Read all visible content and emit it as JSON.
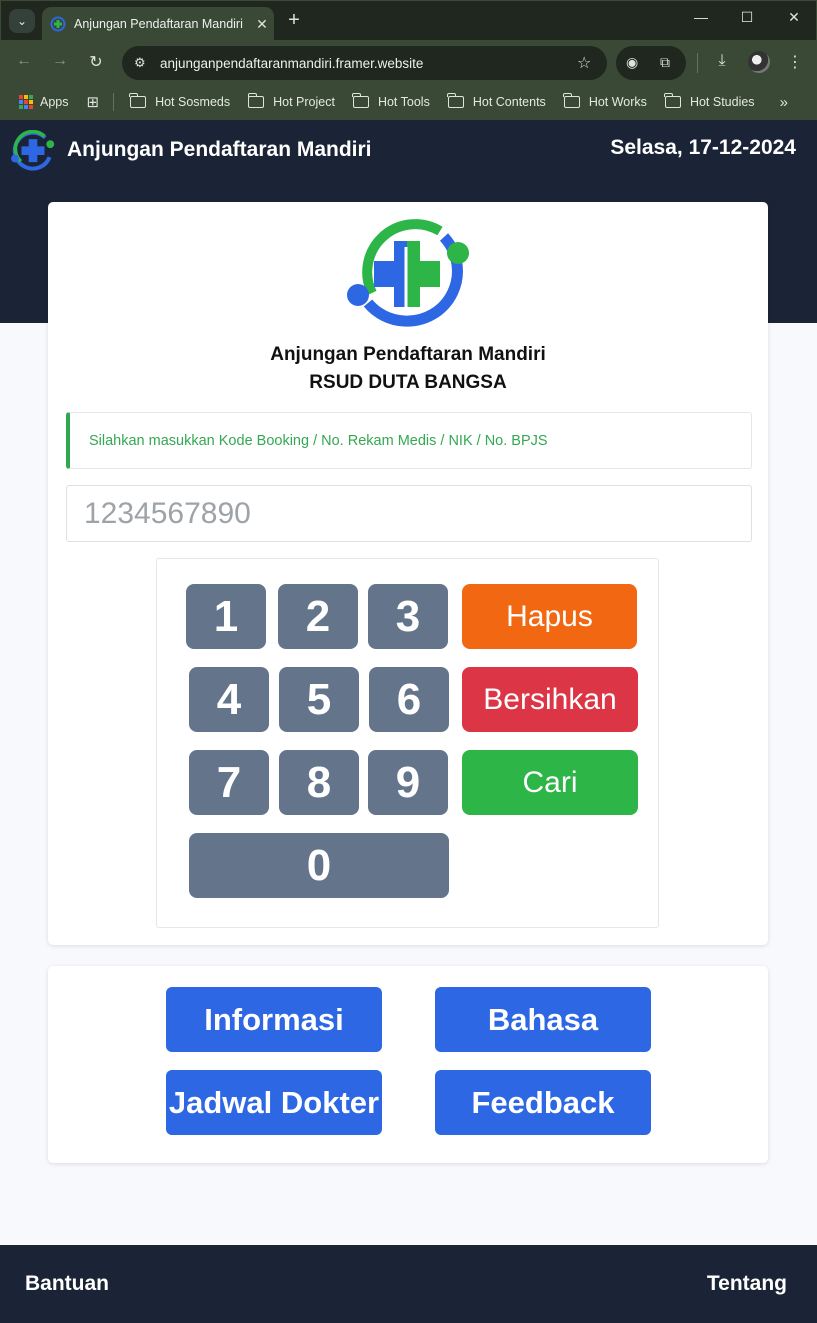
{
  "browser": {
    "tab_title": "Anjungan Pendaftaran Mandiri",
    "url": "anjunganpendaftaranmandiri.framer.website",
    "bookmarks": {
      "apps": "Apps",
      "items": [
        "Hot Sosmeds",
        "Hot Project",
        "Hot Tools",
        "Hot Contents",
        "Hot Works",
        "Hot Studies"
      ]
    },
    "icons": {
      "back": "arrow-left-icon",
      "forward": "arrow-right-icon",
      "reload": "reload-icon",
      "bookmark": "star-icon",
      "download": "download-icon",
      "more": "kebab-menu-icon"
    }
  },
  "header": {
    "title": "Anjungan Pendaftaran Mandiri",
    "date": "Selasa, 17-12-2024"
  },
  "main": {
    "title_line1": "Anjungan Pendaftaran Mandiri",
    "title_line2": "RSUD DUTA BANGSA",
    "notice": "Silahkan masukkan Kode Booking / No. Rekam Medis / NIK / No. BPJS",
    "input_placeholder": "1234567890",
    "input_value": ""
  },
  "keypad": {
    "k1": "1",
    "k2": "2",
    "k3": "3",
    "k4": "4",
    "k5": "5",
    "k6": "6",
    "k7": "7",
    "k8": "8",
    "k9": "9",
    "k0": "0",
    "hapus": "Hapus",
    "bersihkan": "Bersihkan",
    "cari": "Cari"
  },
  "menu": {
    "informasi": "Informasi",
    "bahasa": "Bahasa",
    "jadwal_dokter": "Jadwal Dokter",
    "feedback": "Feedback"
  },
  "footer": {
    "bantuan": "Bantuan",
    "tentang": "Tentang"
  },
  "colors": {
    "header_bg": "#1b2436",
    "accent_blue": "#2d67e3",
    "key_gray": "#64748b",
    "hapus_orange": "#f26812",
    "bersihkan_red": "#dc3545",
    "cari_green": "#2db548",
    "notice_green": "#34a853"
  }
}
